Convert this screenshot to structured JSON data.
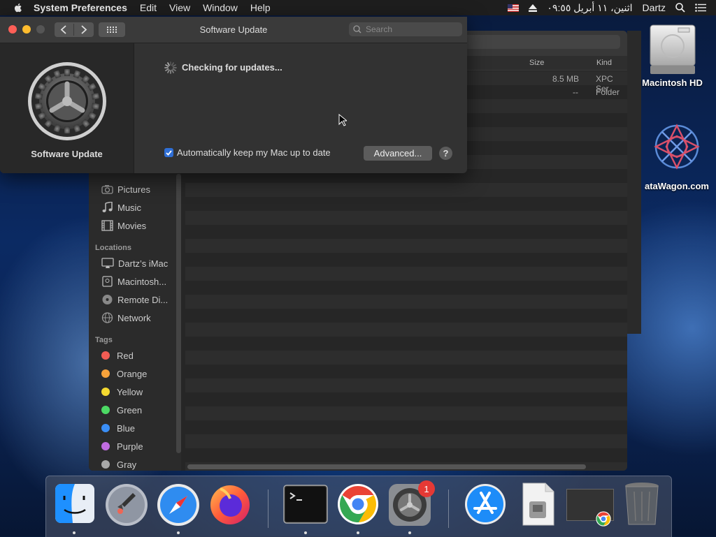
{
  "menubar": {
    "app_name": "System Preferences",
    "items": [
      "Edit",
      "View",
      "Window",
      "Help"
    ],
    "clock": "اثنين، ١١ أبريل ٠٩:٥٥",
    "user": "Dartz"
  },
  "software_update": {
    "title": "Software Update",
    "search_placeholder": "Search",
    "pane_name": "Software Update",
    "status": "Checking for updates...",
    "auto_update_label": "Automatically keep my Mac up to date",
    "auto_update_checked": true,
    "advanced_label": "Advanced...",
    "help_label": "?"
  },
  "finder": {
    "columns": {
      "size": "Size",
      "kind": "Kind"
    },
    "rows": [
      {
        "size": "8.5 MB",
        "kind": "XPC Ser"
      },
      {
        "size": "--",
        "kind": "Folder"
      }
    ],
    "favorites": [
      "Pictures",
      "Music",
      "Movies"
    ],
    "locations_header": "Locations",
    "locations": [
      "Dartz’s iMac",
      "Macintosh...",
      "Remote Di...",
      "Network"
    ],
    "tags_header": "Tags",
    "tags": [
      {
        "label": "Red",
        "color": "#f25c54"
      },
      {
        "label": "Orange",
        "color": "#f7a23b"
      },
      {
        "label": "Yellow",
        "color": "#f4d930"
      },
      {
        "label": "Green",
        "color": "#4cd964"
      },
      {
        "label": "Blue",
        "color": "#3a8ef6"
      },
      {
        "label": "Purple",
        "color": "#c06ce0"
      },
      {
        "label": "Gray",
        "color": "#a8a8a8"
      }
    ]
  },
  "desktop": {
    "drive_label": "Macintosh HD",
    "site_label": "ataWagon.com"
  },
  "dock": {
    "apps": [
      "finder",
      "launchpad",
      "safari",
      "firefox",
      "terminal",
      "chrome",
      "system-preferences",
      "app-store",
      "preview",
      "chrome-window",
      "trash"
    ],
    "sysprefs_badge": "1"
  }
}
